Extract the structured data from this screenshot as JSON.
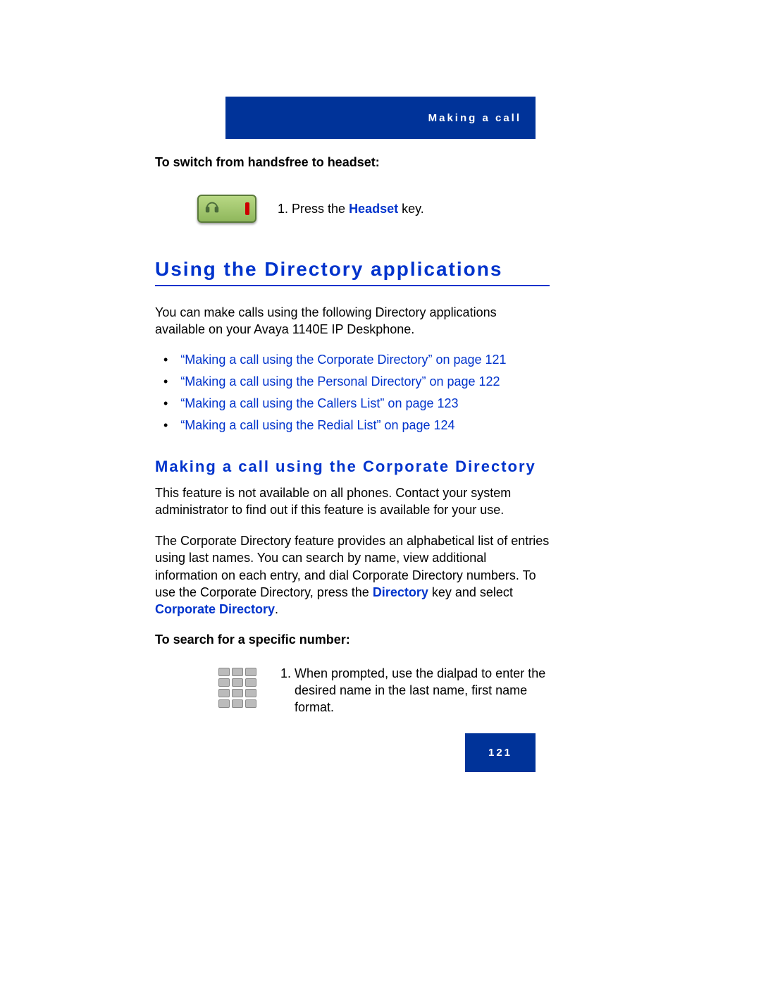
{
  "header": {
    "title": "Making a call"
  },
  "switch": {
    "heading": "To switch from handsfree to headset:",
    "step_prefix": "1.   Press the ",
    "headset_word": "Headset",
    "step_suffix": " key."
  },
  "section": {
    "title": "Using the Directory applications",
    "intro": "You can make calls using the following Directory applications available on your Avaya 1140E IP Deskphone.",
    "links": [
      "“Making a call using the Corporate Directory” on page 121",
      "“Making a call using the Personal Directory” on page 122",
      "“Making a call using the Callers List” on page 123",
      "“Making a call using the Redial List” on page 124"
    ]
  },
  "sub": {
    "title": "Making a call using the Corporate Directory",
    "para1": "This feature is not available on all phones. Contact your system administrator to find out if this feature is available for your use.",
    "para2_a": "The Corporate Directory feature provides an alphabetical list of entries using last names. You can search by name, view additional information on each entry, and dial Corporate Directory numbers. To use the Corporate Directory, press the ",
    "dir_word": "Directory",
    "para2_b": " key and select ",
    "corp_word": "Corporate Directory",
    "para2_c": ".",
    "search_heading": "To search for a specific number:",
    "dialpad_step": "When prompted, use the dialpad to enter the desired name in the last name, first name format."
  },
  "page_number": "121"
}
